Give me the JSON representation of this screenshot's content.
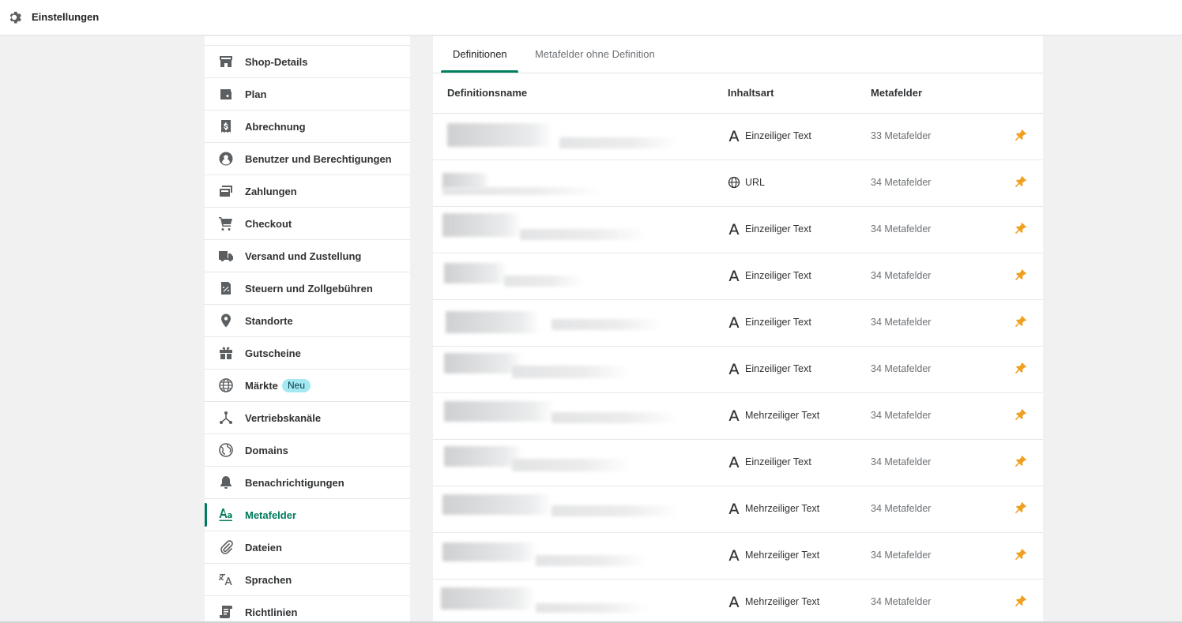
{
  "topbar": {
    "title": "Einstellungen",
    "icon": "gear-icon"
  },
  "sidebar": {
    "items": [
      {
        "label": "Shop-Details",
        "icon": "store-icon"
      },
      {
        "label": "Plan",
        "icon": "wallet-icon"
      },
      {
        "label": "Abrechnung",
        "icon": "bill-icon"
      },
      {
        "label": "Benutzer und Berechtigungen",
        "icon": "user-circle-icon"
      },
      {
        "label": "Zahlungen",
        "icon": "payments-icon"
      },
      {
        "label": "Checkout",
        "icon": "cart-icon"
      },
      {
        "label": "Versand und Zustellung",
        "icon": "truck-icon"
      },
      {
        "label": "Steuern und Zollgebühren",
        "icon": "tax-icon"
      },
      {
        "label": "Standorte",
        "icon": "location-pin-icon"
      },
      {
        "label": "Gutscheine",
        "icon": "gift-icon"
      },
      {
        "label": "Märkte",
        "icon": "globe-icon",
        "badge": "Neu"
      },
      {
        "label": "Vertriebskanäle",
        "icon": "channels-icon"
      },
      {
        "label": "Domains",
        "icon": "globe-domain-icon"
      },
      {
        "label": "Benachrichtigungen",
        "icon": "bell-icon"
      },
      {
        "label": "Metafelder",
        "icon": "metafields-icon",
        "active": true
      },
      {
        "label": "Dateien",
        "icon": "paperclip-icon"
      },
      {
        "label": "Sprachen",
        "icon": "translate-icon"
      },
      {
        "label": "Richtlinien",
        "icon": "policy-icon"
      }
    ],
    "active_color": "#007a5c",
    "badge_color": "#a4e8f2"
  },
  "main": {
    "tabs": [
      {
        "label": "Definitionen",
        "selected": true
      },
      {
        "label": "Metafelder ohne Definition",
        "selected": false
      }
    ],
    "columns": [
      "Definitionsname",
      "Inhaltsart",
      "Metafelder"
    ],
    "rows": [
      {
        "name": "",
        "type": "Einzeiliger Text",
        "type_icon": "text-a-icon",
        "count": "33 Metafelder"
      },
      {
        "name": "",
        "type": "URL",
        "type_icon": "globe-url-icon",
        "count": "34 Metafelder"
      },
      {
        "name": "",
        "type": "Einzeiliger Text",
        "type_icon": "text-a-icon",
        "count": "34 Metafelder"
      },
      {
        "name": "",
        "type": "Einzeiliger Text",
        "type_icon": "text-a-icon",
        "count": "34 Metafelder"
      },
      {
        "name": "",
        "type": "Einzeiliger Text",
        "type_icon": "text-a-icon",
        "count": "34 Metafelder"
      },
      {
        "name": "",
        "type": "Einzeiliger Text",
        "type_icon": "text-a-icon",
        "count": "34 Metafelder"
      },
      {
        "name": "",
        "type": "Mehrzeiliger Text",
        "type_icon": "text-a-icon",
        "count": "34 Metafelder"
      },
      {
        "name": "",
        "type": "Einzeiliger Text",
        "type_icon": "text-a-icon",
        "count": "34 Metafelder"
      },
      {
        "name": "",
        "type": "Mehrzeiliger Text",
        "type_icon": "text-a-icon",
        "count": "34 Metafelder"
      },
      {
        "name": "",
        "type": "Mehrzeiliger Text",
        "type_icon": "text-a-icon",
        "count": "34 Metafelder"
      },
      {
        "name": "",
        "type": "Mehrzeiliger Text",
        "type_icon": "text-a-icon",
        "count": "34 Metafelder"
      }
    ],
    "pin_icon": "pin-icon",
    "pin_color": "#f0a020"
  }
}
